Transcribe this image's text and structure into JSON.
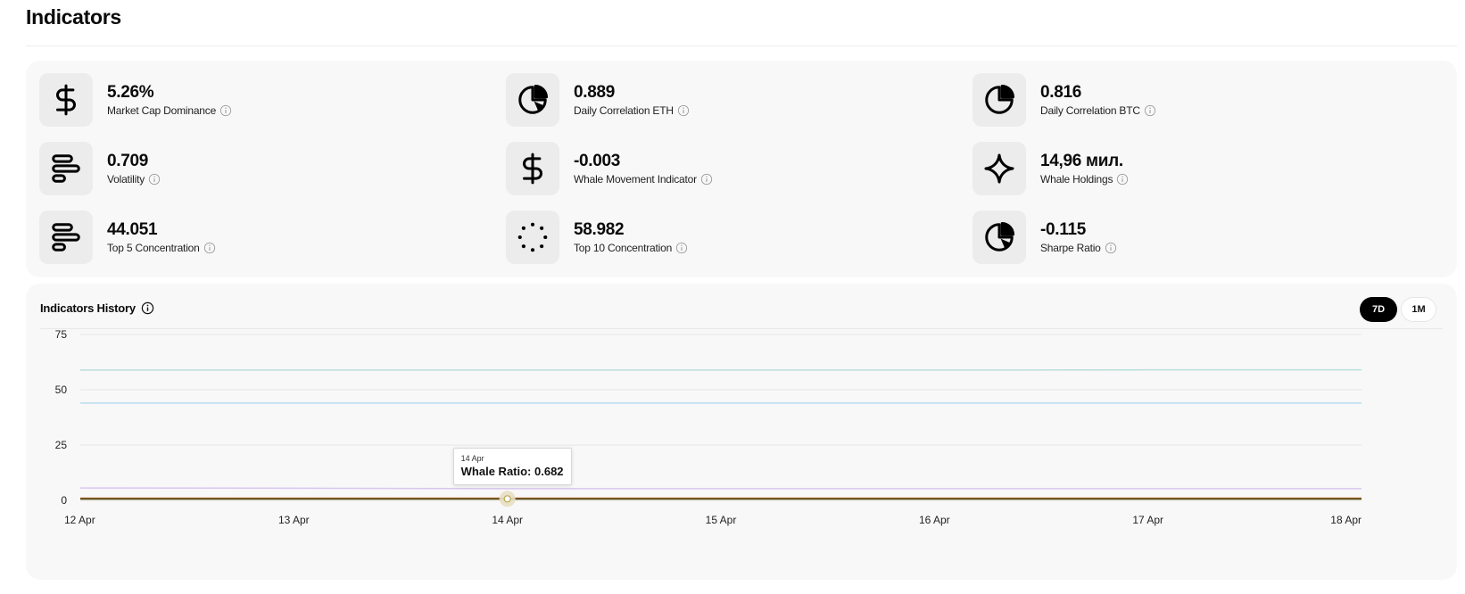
{
  "page": {
    "title": "Indicators"
  },
  "metrics": [
    {
      "value": "5.26%",
      "label": "Market Cap Dominance",
      "icon": "dollar-icon"
    },
    {
      "value": "0.889",
      "label": "Daily Correlation ETH",
      "icon": "pie-chart-icon"
    },
    {
      "value": "0.816",
      "label": "Daily Correlation BTC",
      "icon": "pie-chart-icon"
    },
    {
      "value": "0.709",
      "label": "Volatility",
      "icon": "bars-icon"
    },
    {
      "value": "-0.003",
      "label": "Whale Movement Indicator",
      "icon": "dollar-icon"
    },
    {
      "value": "14,96 мил.",
      "label": "Whale Holdings",
      "icon": "sparkle-icon"
    },
    {
      "value": "44.051",
      "label": "Top 5 Concentration",
      "icon": "bars-icon"
    },
    {
      "value": "58.982",
      "label": "Top 10 Concentration",
      "icon": "loader-icon"
    },
    {
      "value": "-0.115",
      "label": "Sharpe Ratio",
      "icon": "pie-chart-icon"
    }
  ],
  "history": {
    "title": "Indicators History",
    "ranges": [
      "7D",
      "1M"
    ],
    "selected_range": "7D",
    "tooltip": {
      "date": "14 Apr",
      "label": "Whale Ratio: 0.682"
    }
  },
  "chart_data": {
    "type": "line",
    "x": [
      "12 Apr",
      "13 Apr",
      "14 Apr",
      "15 Apr",
      "16 Apr",
      "17 Apr",
      "18 Apr"
    ],
    "ylim": [
      0,
      75
    ],
    "yticks": [
      0,
      25,
      50,
      75
    ],
    "grid": true,
    "series": [
      {
        "values": [
          58.9,
          58.9,
          58.9,
          58.9,
          58.9,
          59.0,
          59.0
        ],
        "color": "#b8dfd8"
      },
      {
        "values": [
          44.0,
          44.0,
          44.0,
          44.0,
          44.0,
          44.0,
          44.0
        ],
        "color": "#b9dcef"
      },
      {
        "values": [
          5.6,
          5.5,
          5.3,
          5.3,
          5.3,
          5.3,
          5.3
        ],
        "color": "#d9c6ef"
      },
      {
        "values": [
          0.9,
          0.9,
          0.9,
          0.9,
          0.9,
          0.9,
          0.9
        ],
        "color": "#ff8a5c"
      },
      {
        "values": [
          0.7,
          0.7,
          0.7,
          0.7,
          0.7,
          0.7,
          0.7
        ],
        "color": "#c9b33b"
      },
      {
        "values": [
          0.682,
          0.682,
          0.682,
          0.682,
          0.682,
          0.682,
          0.682
        ],
        "color": "#5a4a1a"
      }
    ],
    "highlight": {
      "x": "14 Apr",
      "y": 0.682
    }
  },
  "colors": {
    "accent": "#000000",
    "panel_bg": "#f8f8f8",
    "icon_bg": "#ececec"
  }
}
